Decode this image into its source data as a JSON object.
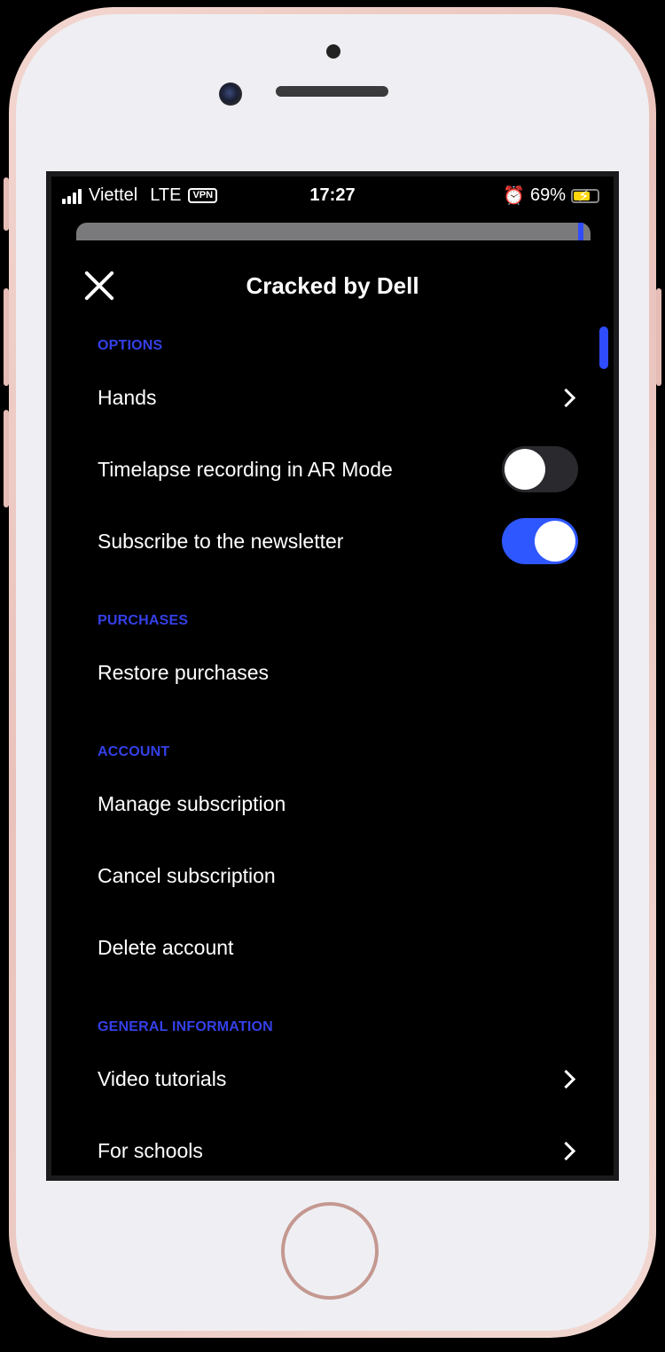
{
  "statusbar": {
    "carrier": "Viettel",
    "network": "LTE",
    "vpn": "VPN",
    "time": "17:27",
    "battery": "69%"
  },
  "header": {
    "title": "Cracked by Dell"
  },
  "sections": {
    "options": "OPTIONS",
    "purchases": "PURCHASES",
    "account": "ACCOUNT",
    "general": "GENERAL INFORMATION"
  },
  "items": {
    "hands": "Hands",
    "timelapse": "Timelapse recording in AR Mode",
    "newsletter": "Subscribe to the newsletter",
    "restore": "Restore purchases",
    "manage": "Manage subscription",
    "cancel": "Cancel subscription",
    "delete": "Delete account",
    "tutorials": "Video tutorials",
    "schools": "For schools"
  },
  "toggles": {
    "timelapse_on": false,
    "newsletter_on": true
  },
  "colors": {
    "accent": "#2f57ff",
    "section_label": "#3440e8"
  },
  "icons": [
    "close-icon",
    "chevron-right-icon",
    "alarm-icon",
    "battery-icon",
    "signal-icon"
  ]
}
